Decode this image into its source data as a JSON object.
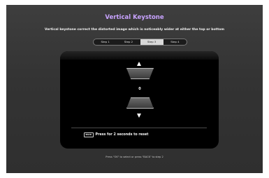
{
  "header": {
    "title": "Vertical Keystone",
    "description": "Vertical keystone correct the distorted image which is noticeably wider at either the top or bottom"
  },
  "steps": [
    {
      "label": "Step 1",
      "active": false
    },
    {
      "label": "Step 2",
      "active": false
    },
    {
      "label": "Step 3",
      "active": true
    },
    {
      "label": "Step 4",
      "active": false
    }
  ],
  "keystone": {
    "value": "0",
    "increase_icon": "triangle-up-icon",
    "decrease_icon": "triangle-down-icon"
  },
  "reset": {
    "key_label": "BACK",
    "text": "Press for 2 seconds to reset"
  },
  "footer": {
    "hint": "Press \"OK\" to select or press \"BACK\" to step 2"
  },
  "colors": {
    "title": "#c8a3ff",
    "background": "#333333",
    "panel": "#000000"
  }
}
